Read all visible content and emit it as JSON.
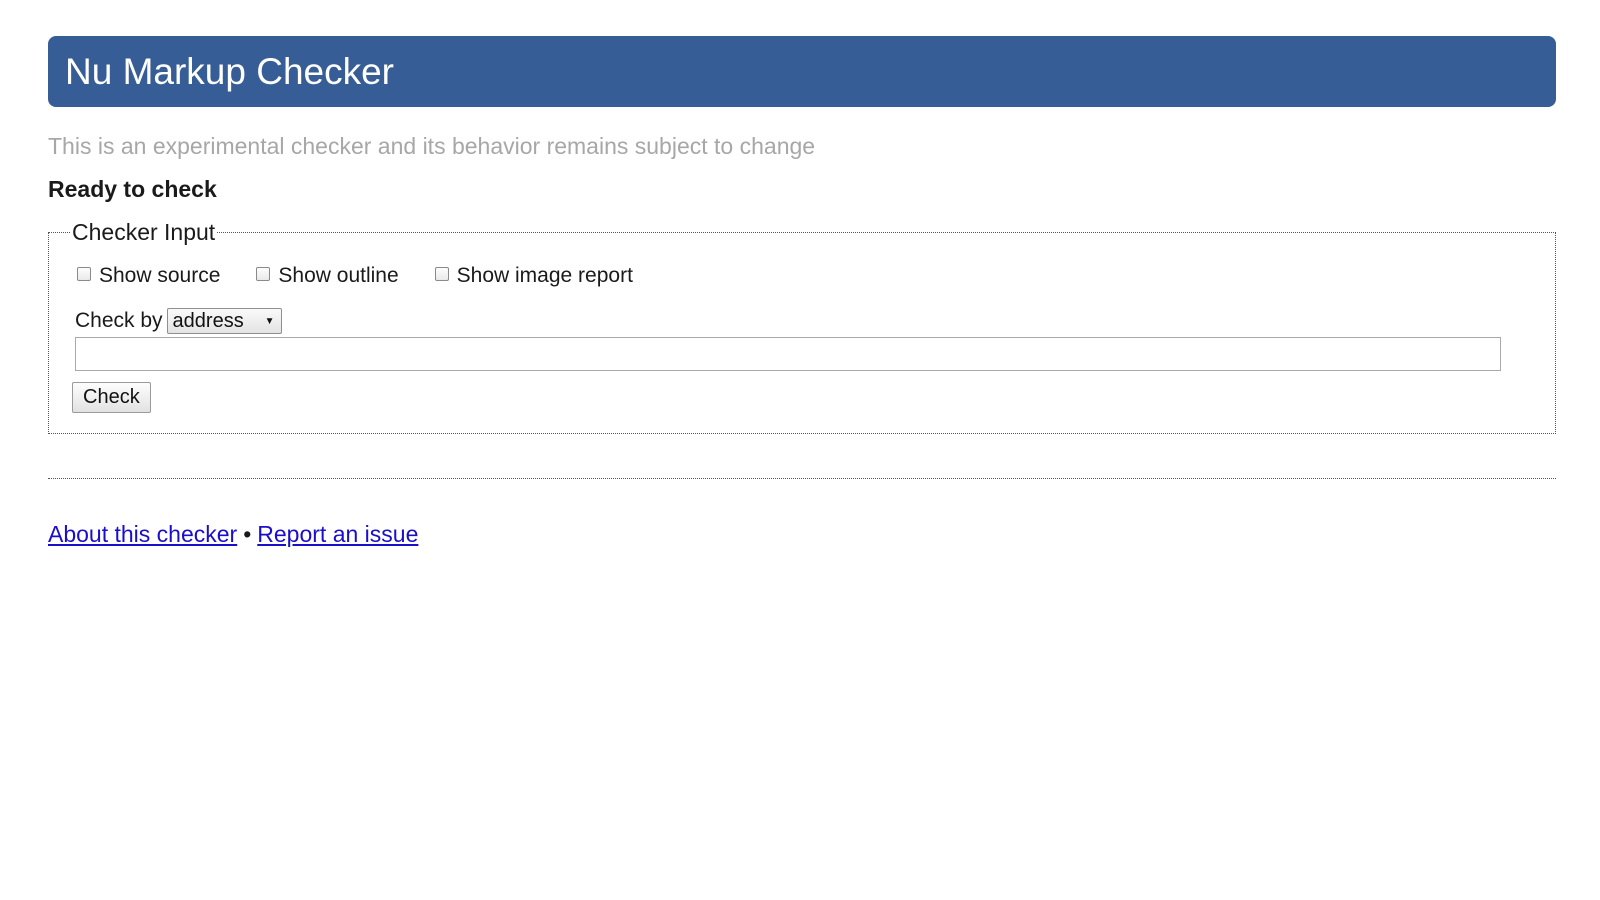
{
  "header": {
    "title": "Nu Markup Checker"
  },
  "subtitle": "This is an experimental checker and its behavior remains subject to change",
  "status": "Ready to check",
  "checker_input": {
    "legend": "Checker Input",
    "options": [
      {
        "label": "Show source",
        "checked": false
      },
      {
        "label": "Show outline",
        "checked": false
      },
      {
        "label": "Show image report",
        "checked": false
      }
    ],
    "check_by_label": "Check by",
    "check_by_selected": "address",
    "address_value": "",
    "check_button_label": "Check"
  },
  "footer": {
    "about_link": "About this checker",
    "separator": "•",
    "report_link": "Report an issue"
  },
  "colors": {
    "header_bg": "#365d95",
    "link": "#1a0dcc",
    "subtitle": "#a7a7a7"
  }
}
